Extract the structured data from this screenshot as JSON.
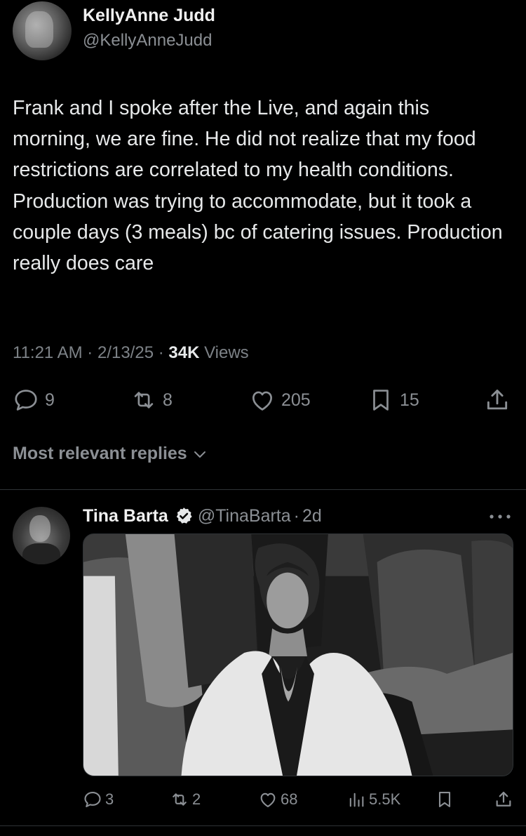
{
  "tweet": {
    "author_name": "KellyAnne Judd",
    "author_handle": "@KellyAnneJudd",
    "text": "Frank and I spoke after the Live, and again this morning, we are fine. He did not realize that my food restrictions are correlated to my health conditions. Production was trying to accommodate, but it took a couple days (3 meals) bc of catering issues. Production really does care",
    "time": "11:21 AM",
    "date": "2/13/25",
    "views_count": "34K",
    "views_label": "Views",
    "replies": "9",
    "reposts": "8",
    "likes": "205",
    "bookmarks": "15"
  },
  "sort": {
    "label": "Most relevant replies"
  },
  "reply": {
    "author_name": "Tina Barta",
    "author_handle": "@TinaBarta",
    "age": "2d",
    "replies": "3",
    "reposts": "2",
    "likes": "68",
    "views": "5.5K"
  },
  "icons": {
    "reply": "speech-bubble-icon",
    "repost": "repost-icon",
    "like": "heart-icon",
    "bookmark": "bookmark-icon",
    "share": "share-icon",
    "views": "bar-chart-icon",
    "verified": "verified-badge-icon",
    "more": "more-horizontal-icon",
    "chevron": "chevron-down-icon"
  },
  "colors": {
    "background": "#000000",
    "text": "#e7e9ea",
    "muted": "#8b8f94",
    "divider": "#2f3336"
  }
}
